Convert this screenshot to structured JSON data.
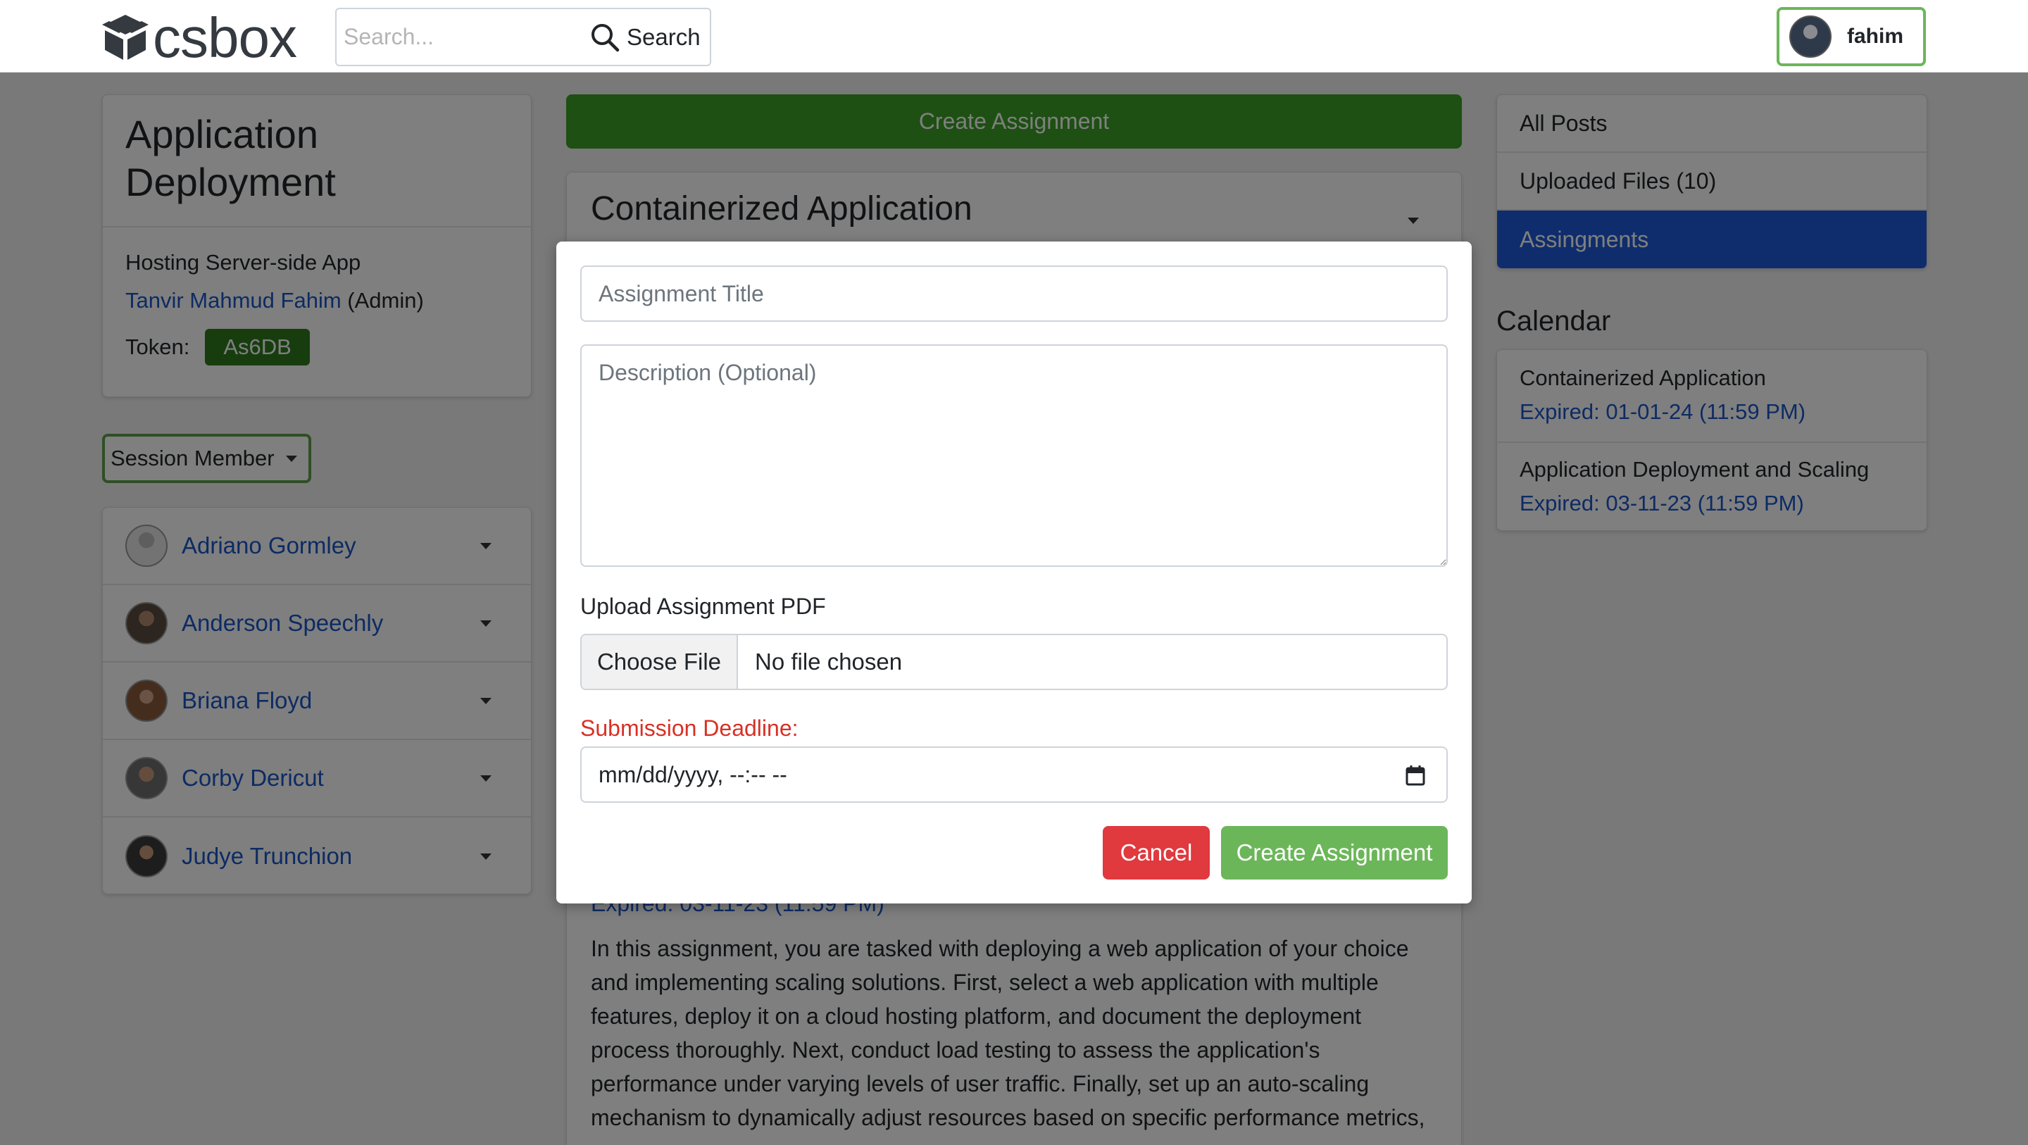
{
  "navbar": {
    "logo_text": "csbox",
    "search_placeholder": "Search...",
    "search_button_label": "Search",
    "user_name": "fahim"
  },
  "course": {
    "title": "Application Deployment",
    "subtitle": "Hosting Server-side App",
    "owner_name": "Tanvir Mahmud Fahim",
    "owner_role": "(Admin)",
    "token_label": "Token:",
    "token_value": "As6DB"
  },
  "session_member": {
    "label": "Session Member",
    "members": [
      {
        "name": "Adriano Gormley"
      },
      {
        "name": "Anderson Speechly"
      },
      {
        "name": "Briana Floyd"
      },
      {
        "name": "Corby Dericut"
      },
      {
        "name": "Judye Trunchion"
      }
    ]
  },
  "center": {
    "create_button_label": "Create Assignment",
    "assignment_title": "Containerized Application",
    "expired_text": "Expired: 03-11-23 (11:59 PM)",
    "description": "In this assignment, you are tasked with deploying a web application of your choice and implementing scaling solutions. First, select a web application with multiple features, deploy it on a cloud hosting platform, and document the deployment process thoroughly. Next, conduct load testing to assess the application's performance under varying levels of user traffic. Finally, set up an auto-scaling mechanism to dynamically adjust resources based on specific performance metrics,"
  },
  "right_tabs": {
    "items": [
      {
        "label": "All Posts"
      },
      {
        "label": "Uploaded Files (10)"
      },
      {
        "label": "Assingments"
      }
    ],
    "active_index": 2
  },
  "calendar": {
    "title": "Calendar",
    "items": [
      {
        "title": "Containerized Application",
        "expired": "Expired: 01-01-24 (11:59 PM)"
      },
      {
        "title": "Application Deployment and Scaling",
        "expired": "Expired: 03-11-23 (11:59 PM)"
      }
    ]
  },
  "modal": {
    "title_placeholder": "Assignment Title",
    "description_placeholder": "Description (Optional)",
    "upload_label": "Upload Assignment PDF",
    "choose_file_label": "Choose File",
    "no_file_text": "No file chosen",
    "deadline_label": "Submission Deadline:",
    "date_value": "mm/dd/yyyy, --:-- --",
    "cancel_label": "Cancel",
    "create_label": "Create Assignment"
  },
  "colors": {
    "primary_green": "#6cb65a",
    "active_blue": "#1e5bd8",
    "link_blue": "#1a56c7",
    "danger_red": "#e0393e",
    "deadline_red": "#d93025"
  }
}
